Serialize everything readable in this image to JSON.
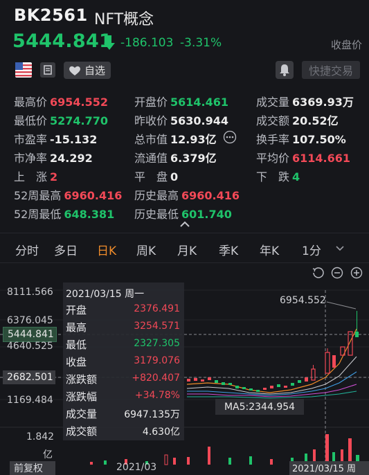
{
  "header": {
    "code": "BK2561",
    "name": "NFT概念",
    "price": "5444.841",
    "change": "-186.103",
    "change_pct": "-3.31%",
    "status": "收盘价"
  },
  "actions": {
    "favorite_label": "自选",
    "quick_trade_label": "快捷交易"
  },
  "stats": {
    "high_label": "最高价",
    "high": "6954.552",
    "open_label": "开盘价",
    "open": "5614.461",
    "volume_label": "成交量",
    "volume": "6369.93万",
    "low_label": "最低价",
    "low": "5274.770",
    "prev_close_label": "昨收价",
    "prev_close": "5630.944",
    "turnover_label": "成交额",
    "turnover": "20.52亿",
    "pe_label": "市盈率",
    "pe": "-15.132",
    "mkt_cap_label": "总市值",
    "mkt_cap": "12.93亿",
    "turnover_rate_label": "换手率",
    "turnover_rate": "107.50%",
    "pb_label": "市净率",
    "pb": "24.292",
    "float_cap_label": "流通值",
    "float_cap": "6.379亿",
    "avg_label": "平均价",
    "avg": "6114.661",
    "up_label": "上　涨",
    "up": "2",
    "flat_label": "平　盘",
    "flat": "0",
    "down_label": "下　跌",
    "down": "4",
    "w52_high_label": "52周最高",
    "w52_high": "6960.416",
    "hist_high_label": "历史最高",
    "hist_high": "6960.416",
    "w52_low_label": "52周最低",
    "w52_low": "648.381",
    "hist_low_label": "历史最低",
    "hist_low": "601.740"
  },
  "tabs": [
    "分时",
    "多日",
    "日K",
    "周K",
    "月K",
    "季K",
    "年K",
    "1分"
  ],
  "active_tab": "日K",
  "chart": {
    "y_labels": [
      "8111.566",
      "6376.045",
      "5444.841",
      "4640.525",
      "2682.501",
      "1169.484"
    ],
    "peak_label": "6954.552",
    "ma5_label": "MA5:2344.954",
    "vol_label_value": "1.842",
    "vol_label_unit": "亿",
    "bottom_left": "前复权",
    "date_left": "2021/03",
    "date_right": "2021/03/15 周"
  },
  "tooltip": {
    "date": "2021/03/15 周一",
    "rows": [
      {
        "k": "开盘",
        "v": "2376.491",
        "c": "red"
      },
      {
        "k": "最高",
        "v": "3254.571",
        "c": "red"
      },
      {
        "k": "最低",
        "v": "2327.305",
        "c": "green"
      },
      {
        "k": "收盘",
        "v": "3179.076",
        "c": "red"
      },
      {
        "k": "涨跌额",
        "v": "+820.407",
        "c": "red"
      },
      {
        "k": "涨跌幅",
        "v": "+34.78%",
        "c": "red"
      },
      {
        "k": "成交量",
        "v": "6947.135万",
        "c": "white"
      },
      {
        "k": "成交额",
        "v": "4.630亿",
        "c": "white"
      }
    ]
  },
  "colors": {
    "up": "#f24957",
    "down": "#1fc36a",
    "active_tab": "#f08c2b"
  }
}
